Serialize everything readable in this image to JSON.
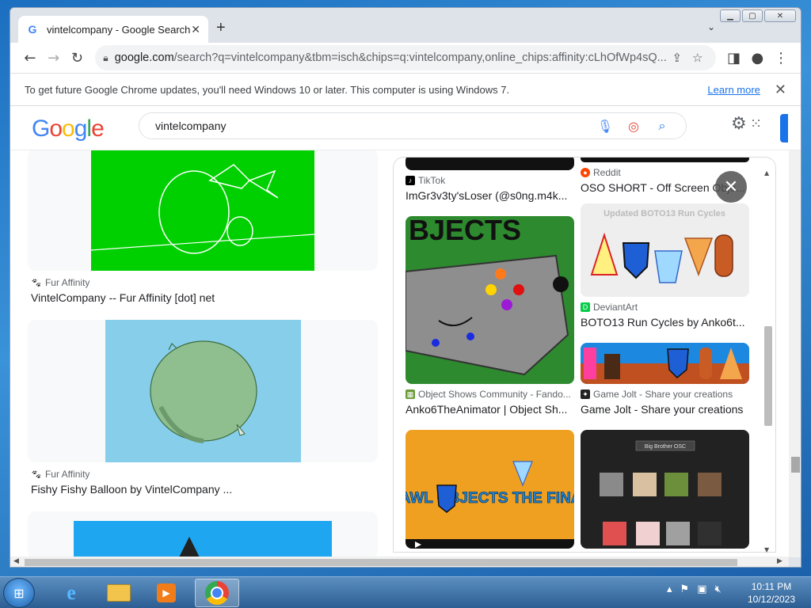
{
  "window": {
    "caption_minimize": "▁",
    "caption_maximize": "▢",
    "caption_close": "✕"
  },
  "tabs": [
    {
      "title": "vintelcompany - Google Search",
      "favicon": "google-g-icon"
    }
  ],
  "toolbar": {
    "url_host": "google.com",
    "url_rest": "/search?q=vintelcompany&tbm=isch&chips=q:vintelcompany,online_chips:affinity:cLhOfWp4sQ...",
    "icons": [
      "back-arrow-icon",
      "forward-arrow-icon",
      "reload-icon",
      "lock-icon",
      "share-icon",
      "star-icon",
      "sidepanel-icon",
      "profile-icon",
      "menu-dots-icon"
    ]
  },
  "infobar": {
    "message": "To get future Google Chrome updates, you'll need Windows 10 or later. This computer is using Windows 7.",
    "learn_more": "Learn more"
  },
  "google": {
    "logo": [
      "G",
      "o",
      "o",
      "g",
      "l",
      "e"
    ],
    "query": "vintelcompany"
  },
  "left_results": [
    {
      "source": "Fur Affinity",
      "title": "VintelCompany -- Fur Affinity [dot] net",
      "thumb_color": "#00d000"
    },
    {
      "source": "Fur Affinity",
      "title": "Fishy Fishy Balloon by VintelCompany ...",
      "thumb_color": "#87ceeb"
    },
    {
      "source": "",
      "title": "",
      "thumb_color": "#1ea7f0"
    }
  ],
  "panel_results": [
    {
      "source": "TikTok",
      "title": "ImGr3v3ty'sLoser (@s0ng.m4k...",
      "thumb_color": "#111111"
    },
    {
      "source": "Reddit",
      "title": "OSO SHORT - Off Screen Obje...",
      "thumb_color": "#111111"
    },
    {
      "source": "TikTok",
      "title": "",
      "thumb_color": "#2e8a2e"
    },
    {
      "source": "DeviantArt",
      "title": "BOTO13 Run Cycles by Anko6t...",
      "thumb_color": "#eeeeee",
      "overlay": "Updated BOTO13 Run Cycles"
    },
    {
      "source": "Object Shows Community - Fando...",
      "title": "Anko6TheAnimator | Object Sh...",
      "thumb_color": "#2e8a2e"
    },
    {
      "source": "Game Jolt - Share your creations",
      "title": "Game Jolt - Share your creations",
      "thumb_color": "#1c88e0"
    },
    {
      "source": "",
      "title": "",
      "thumb_color": "#f0a020",
      "overlay": "BRAWL OBJECTS THE FINALE"
    },
    {
      "source": "",
      "title": "",
      "thumb_color": "#222222",
      "overlay": "Big Brother OSC"
    }
  ],
  "taskbar": {
    "apps": [
      "internet-explorer-icon",
      "file-explorer-icon",
      "media-player-icon",
      "chrome-icon"
    ],
    "time": "10:11 PM",
    "date": "10/12/2023"
  }
}
